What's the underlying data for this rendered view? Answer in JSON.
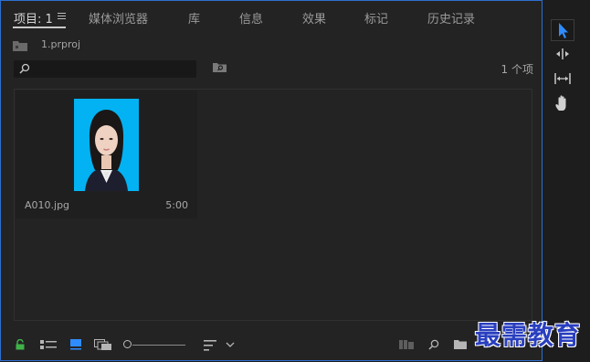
{
  "tabs": [
    {
      "label": "项目: 1"
    },
    {
      "label": "媒体浏览器"
    },
    {
      "label": "库"
    },
    {
      "label": "信息"
    },
    {
      "label": "效果"
    },
    {
      "label": "标记"
    },
    {
      "label": "历史记录"
    }
  ],
  "project": {
    "file_name": "1.prproj"
  },
  "search": {
    "placeholder": "",
    "value": ""
  },
  "item_count": "1 个项",
  "items": [
    {
      "name": "A010.jpg",
      "duration": "5:00"
    }
  ],
  "colors": {
    "panel_bg": "#232323",
    "focus_border": "#2e6fd0",
    "thumb_bg": "#03b2f2",
    "accent_blue": "#2f8cff",
    "lock_green": "#3fb24a"
  },
  "icons": {
    "bottom_toolbar": [
      "lock-icon",
      "list-view-icon",
      "icon-view-icon",
      "freeform-view-icon",
      "zoom-slider",
      "sort-icon",
      "sort-dropdown-icon",
      "automate-to-sequence-icon",
      "find-icon",
      "new-bin-icon",
      "new-item-icon"
    ],
    "tools": [
      "selection-tool-icon",
      "ripple-edit-tool-icon",
      "slip-tool-icon",
      "hand-tool-icon"
    ]
  },
  "watermark": "最需教育"
}
